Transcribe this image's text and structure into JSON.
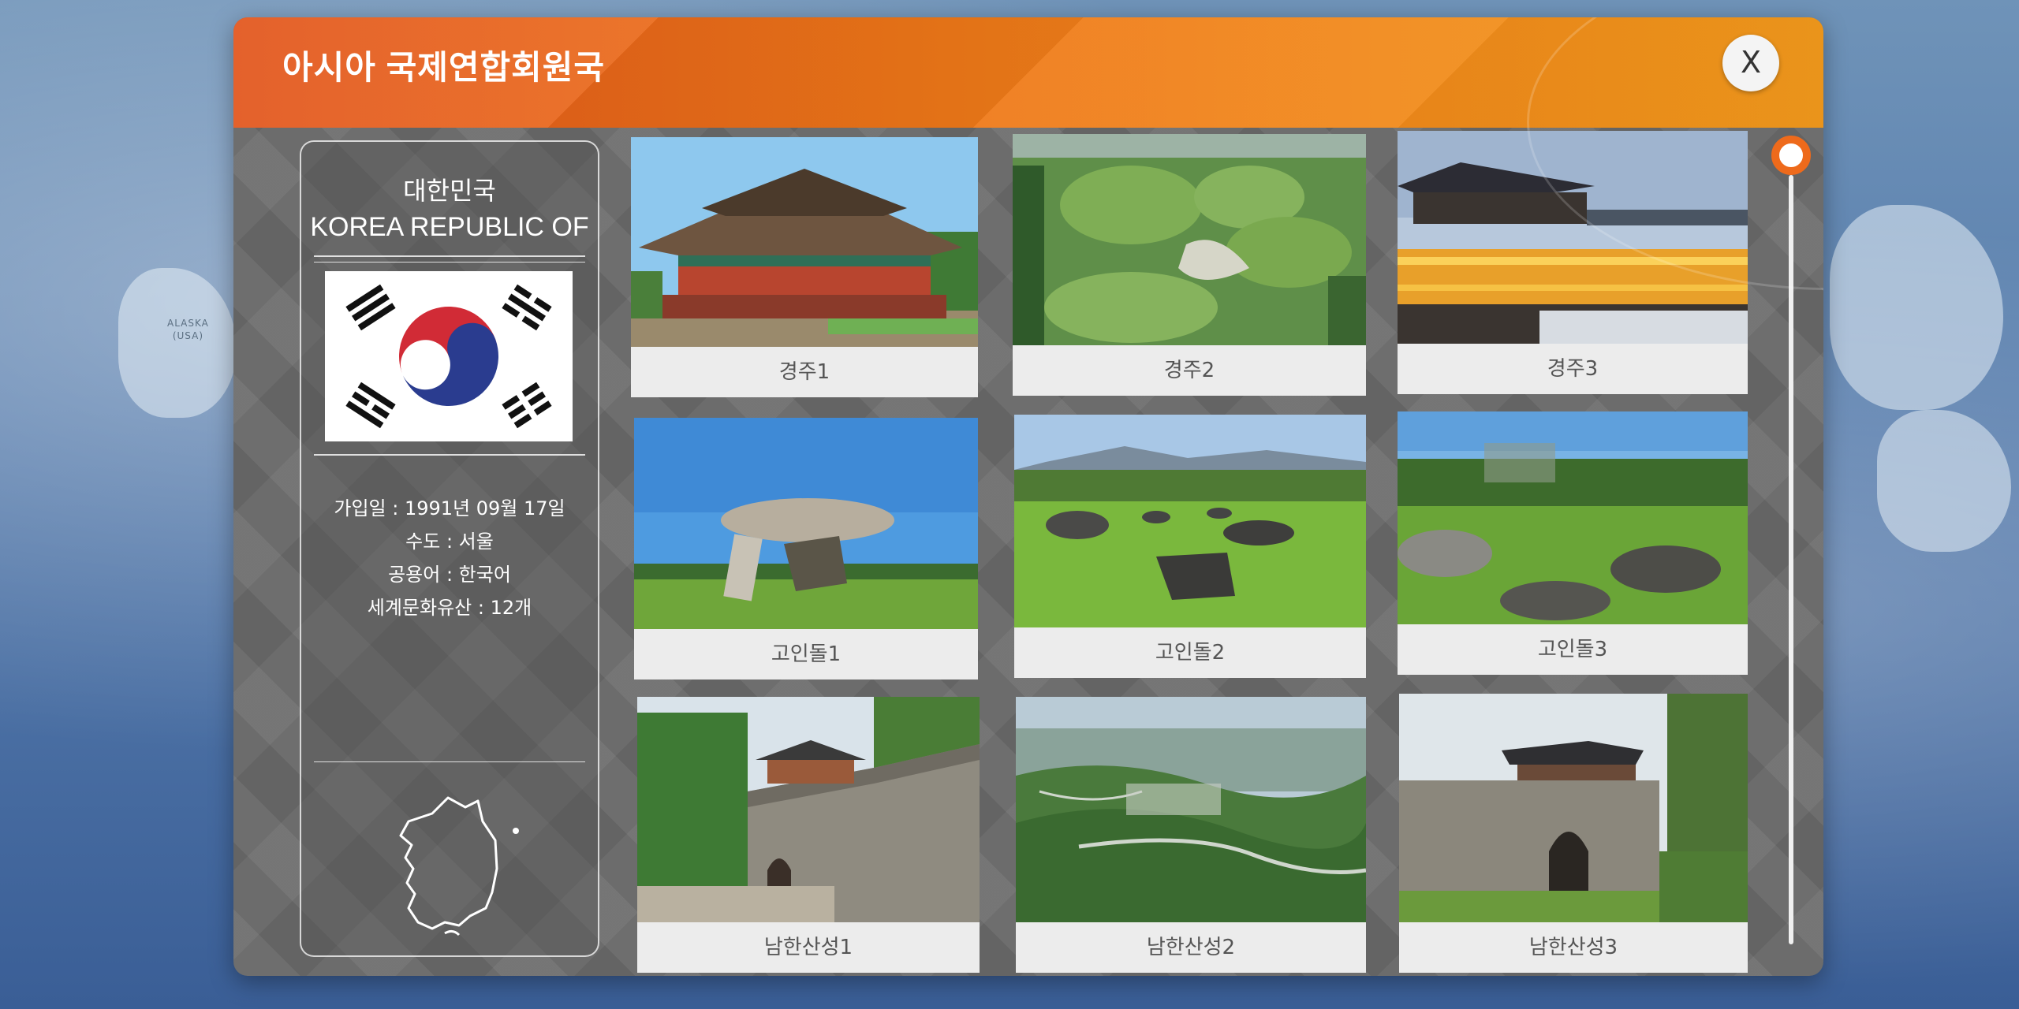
{
  "background": {
    "alaska_label_line1": "ALASKA",
    "alaska_label_line2": "(USA)"
  },
  "window": {
    "title": "아시아 국제연합회원국",
    "close_label": "X",
    "accent_color": "#ef7818"
  },
  "country": {
    "name_ko": "대한민국",
    "name_en": "KOREA REPUBLIC OF",
    "flag_icon": "korea-flag-icon",
    "details": [
      "가입일 : 1991년 09월 17일",
      "수도 : 서울",
      "공용어 : 한국어",
      "세계문화유산 : 12개"
    ],
    "map_icon": "korea-map-icon"
  },
  "gallery": {
    "items": [
      {
        "label": "경주1"
      },
      {
        "label": "경주2"
      },
      {
        "label": "경주3"
      },
      {
        "label": "고인돌1"
      },
      {
        "label": "고인돌2"
      },
      {
        "label": "고인돌3"
      },
      {
        "label": "남한산성1"
      },
      {
        "label": "남한산성2"
      },
      {
        "label": "남한산성3"
      }
    ]
  },
  "scrollbar": {
    "position": 0
  }
}
